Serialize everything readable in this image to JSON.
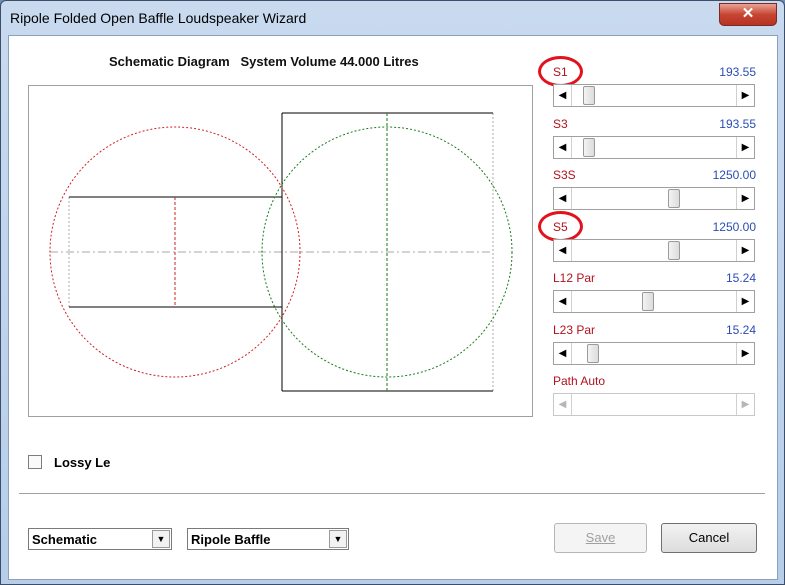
{
  "window": {
    "title": "Ripole Folded Open Baffle Loudspeaker Wizard",
    "close_glyph": "✕"
  },
  "diagram": {
    "title": "Schematic Diagram   System Volume 44.000 Litres"
  },
  "sliders": [
    {
      "label": "S1",
      "value": "193.55",
      "position": 0.07,
      "highlighted": true,
      "enabled": true
    },
    {
      "label": "S3",
      "value": "193.55",
      "position": 0.07,
      "highlighted": false,
      "enabled": true
    },
    {
      "label": "S3S",
      "value": "1250.00",
      "position": 0.63,
      "highlighted": false,
      "enabled": true
    },
    {
      "label": "S5",
      "value": "1250.00",
      "position": 0.63,
      "highlighted": true,
      "enabled": true
    },
    {
      "label": "L12 Par",
      "value": "15.24",
      "position": 0.46,
      "highlighted": false,
      "enabled": true
    },
    {
      "label": "L23 Par",
      "value": "15.24",
      "position": 0.1,
      "highlighted": false,
      "enabled": true
    },
    {
      "label": "Path Auto",
      "value": "",
      "position": null,
      "highlighted": false,
      "enabled": false
    }
  ],
  "options": {
    "lossy_label": "Lossy Le",
    "lossy_checked": false
  },
  "footer": {
    "view_select": "Schematic",
    "type_select": "Ripole Baffle",
    "save_label": "Save",
    "cancel_label": "Cancel"
  },
  "colors": {
    "label_red": "#b2121d",
    "value_blue": "#2a4db3",
    "highlight_red": "#e2121c",
    "circle_red": "#cc2222",
    "circle_green": "#1a7a1a"
  }
}
